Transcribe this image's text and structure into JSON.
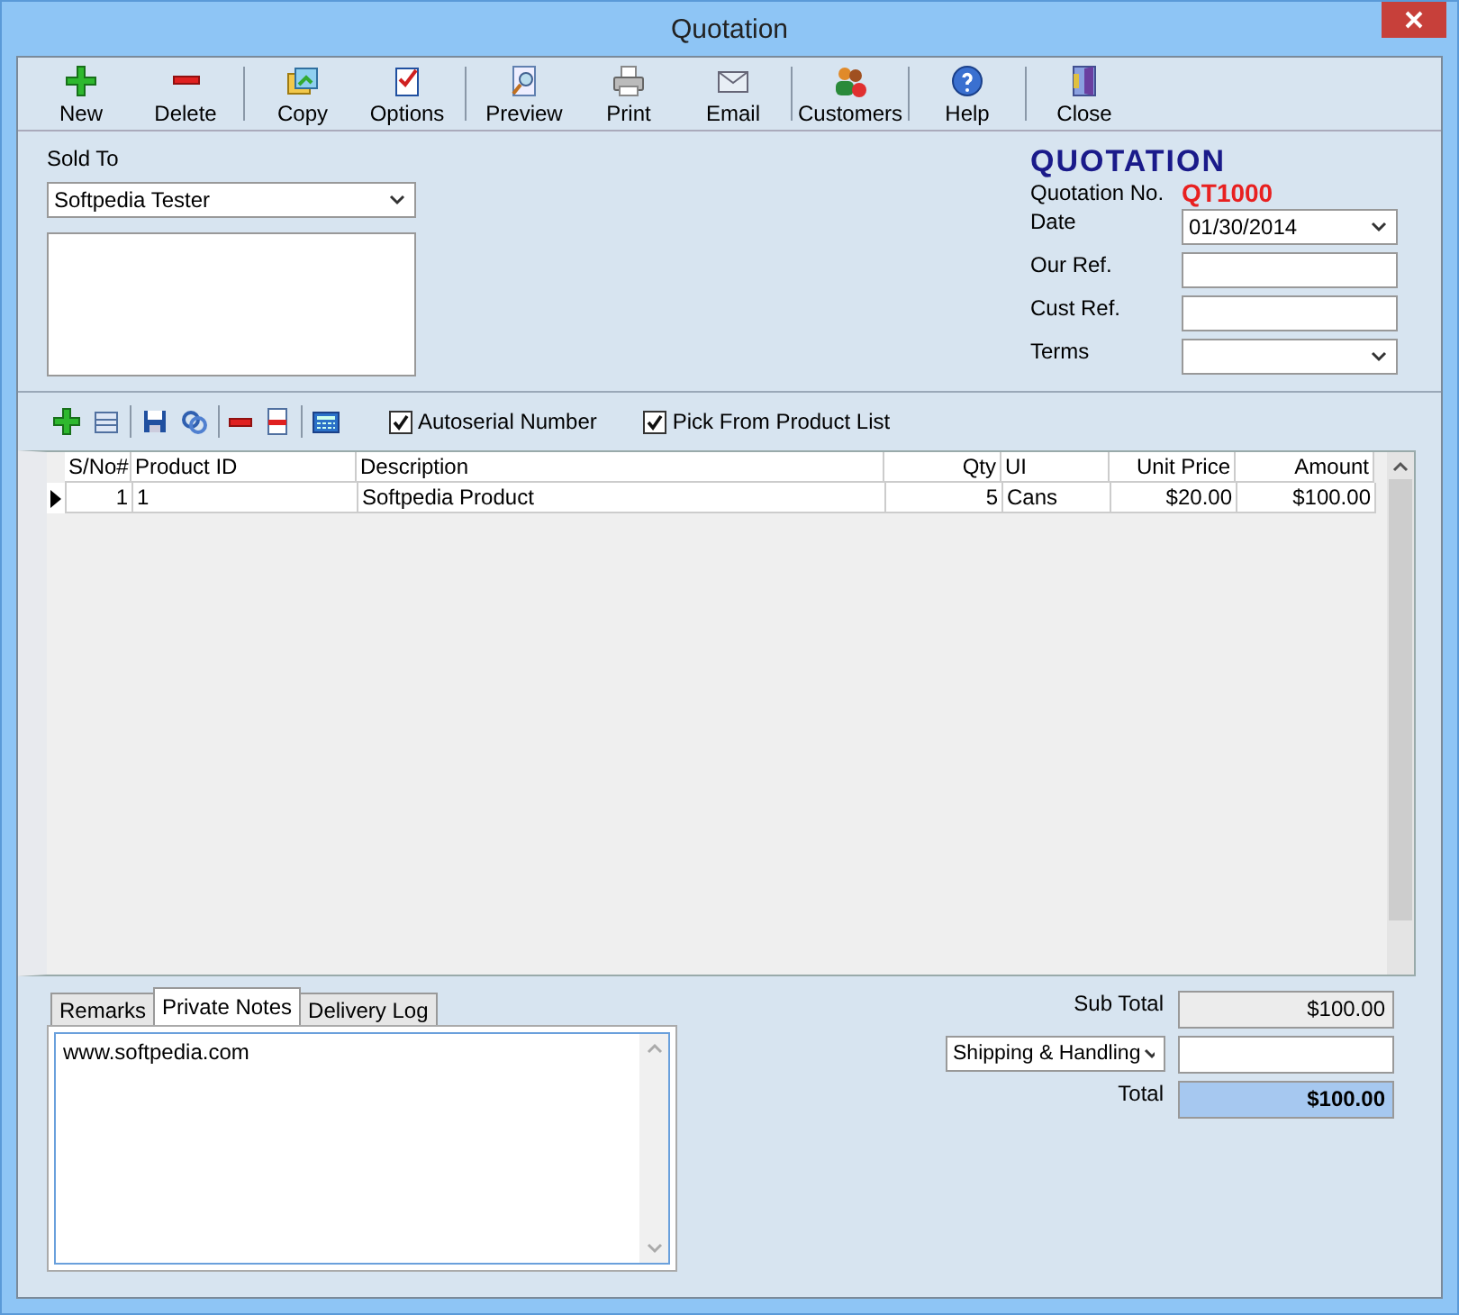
{
  "window": {
    "title": "Quotation"
  },
  "toolbar": [
    [
      {
        "label": "New"
      },
      {
        "label": "Delete"
      }
    ],
    [
      {
        "label": "Copy"
      },
      {
        "label": "Options"
      }
    ],
    [
      {
        "label": "Preview"
      },
      {
        "label": "Print"
      },
      {
        "label": "Email"
      }
    ],
    [
      {
        "label": "Customers"
      }
    ],
    [
      {
        "label": "Help"
      }
    ],
    [
      {
        "label": "Close"
      }
    ]
  ],
  "sold_to": {
    "label": "Sold To",
    "value": "Softpedia Tester"
  },
  "quotation": {
    "heading": "QUOTATION",
    "number_label": "Quotation No.",
    "number": "QT1000",
    "fields": [
      {
        "label": "Date",
        "kind": "select",
        "value": "01/30/2014"
      },
      {
        "label": "Our Ref.",
        "kind": "input"
      },
      {
        "label": "Cust Ref.",
        "kind": "input"
      },
      {
        "label": "Terms",
        "kind": "select"
      }
    ]
  },
  "line_toolbar": {
    "checkboxes": [
      {
        "label": "Autoserial Number",
        "checked": true
      },
      {
        "label": "Pick From Product List",
        "checked": true
      }
    ]
  },
  "table": {
    "columns": [
      "S/No#",
      "Product ID",
      "Description",
      "Qty",
      "UI",
      "Unit Price",
      "Amount"
    ],
    "rows": [
      {
        "current": true,
        "cells": [
          "1",
          "1",
          "Softpedia Product",
          "5",
          "Cans",
          "$20.00",
          "$100.00"
        ]
      }
    ]
  },
  "tabs": [
    {
      "label": "Remarks",
      "selected": false
    },
    {
      "label": "Private Notes",
      "selected": true
    },
    {
      "label": "Delivery Log",
      "selected": false
    }
  ],
  "notes": "www.softpedia.com",
  "totals": {
    "sub_total_label": "Sub Total",
    "sub_total": "$100.00",
    "shipping_label": "Shipping & Handling",
    "total_label": "Total",
    "total": "$100.00"
  }
}
